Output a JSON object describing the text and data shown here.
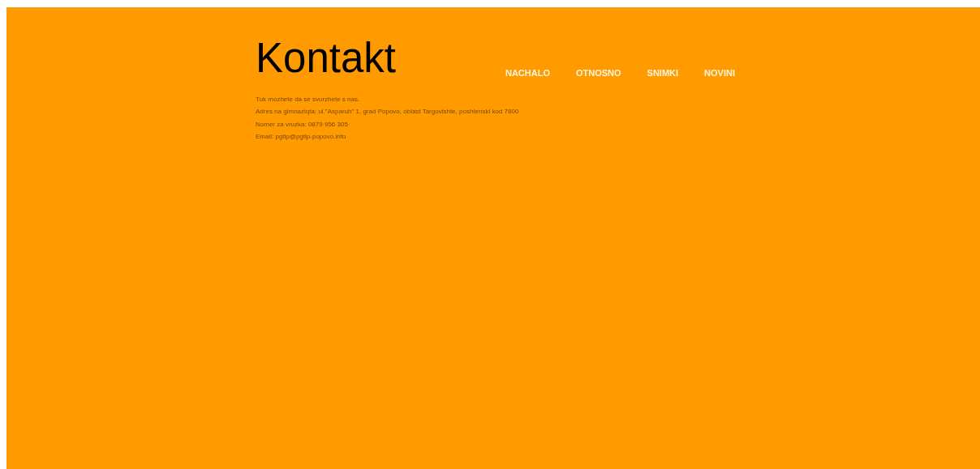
{
  "title": "Kontakt",
  "nav": [
    {
      "label": "NACHALO"
    },
    {
      "label": "OTNOSNO"
    },
    {
      "label": "SNIMKI"
    },
    {
      "label": "NOVINI"
    }
  ],
  "lines": [
    "Tuk mozhete da se svurzhete s nas.",
    "Adres na gimnaziqta: ul.\"Asparuh\" 1, grad Popovo, oblast Targovishte, poshtenski kod 7800",
    "Nomer za vruzka: 0879 956 305",
    "Email: pgtlp@pgtlp-popovo.info"
  ]
}
